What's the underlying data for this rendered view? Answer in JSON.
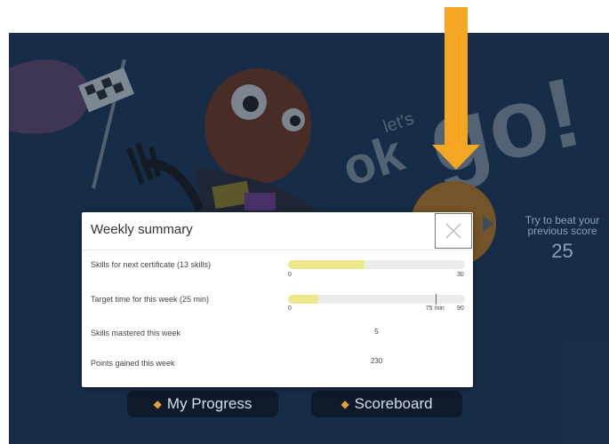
{
  "background": {
    "beat_text": "Try to beat your previous score",
    "beat_score": "25",
    "lets_go": "ok let's go!",
    "buttons": {
      "my_progress": "My Progress",
      "scoreboard": "Scoreboard"
    }
  },
  "modal": {
    "title": "Weekly summary",
    "rows": [
      {
        "label": "Skills for next certificate (13 skills)",
        "progress": 0.43,
        "min": "0",
        "max": "30"
      },
      {
        "label": "Target time for this week (25 min)",
        "progress": 0.17,
        "marker_fraction": 0.833,
        "min": "0",
        "marker": "75 min",
        "max": "90"
      },
      {
        "label": "Skills mastered this week",
        "value": "5"
      },
      {
        "label": "Points gained this week",
        "value": "230"
      }
    ]
  },
  "colors": {
    "scene_bg": "#1f3a58",
    "arrow": "#f5a623",
    "bar_fill": "#ede88c",
    "bar_track": "#ececec"
  }
}
